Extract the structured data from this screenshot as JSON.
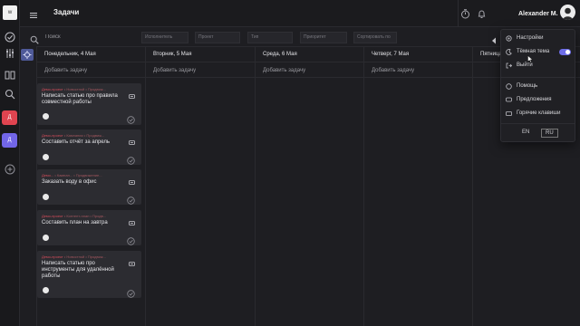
{
  "app": {
    "title": "Задачи",
    "logo_text": "w",
    "user_name": "Alexander M."
  },
  "rail": {
    "projects": [
      {
        "label": "Д",
        "color": "#e04450"
      },
      {
        "label": "Д",
        "color": "#7266e8"
      }
    ]
  },
  "filters": {
    "search_placeholder": "Поиск",
    "assignee": "Исполнитель",
    "project": "Проект",
    "type": "Тип",
    "priority": "Приоритет",
    "sort": "Сортировать по"
  },
  "columns": [
    {
      "day": "Понедельник, 4 Мая",
      "add": "Добавить задачу"
    },
    {
      "day": "Вторник, 5 Мая",
      "add": "Добавить задачу"
    },
    {
      "day": "Среда, 6 Мая",
      "add": "Добавить задачу"
    },
    {
      "day": "Четверг, 7 Мая",
      "add": "Добавить задачу"
    },
    {
      "day": "Пятница",
      "add": ""
    }
  ],
  "cards": [
    {
      "project": "Демо-проект",
      "crumb": " • Новостной • Продвиж...",
      "title": "Написать статью про правила совместной работы"
    },
    {
      "project": "Демо-проект",
      "crumb": " • Кампании • Продвиж...",
      "title": "Составить отчёт за апрель"
    },
    {
      "project": "Демо...",
      "crumb": " • Кампан... • Продвижение...",
      "title": "Заказать воду в офис"
    },
    {
      "project": "Демо-проект",
      "crumb": " • Контент-план • Продв...",
      "title": "Составить план на завтра"
    },
    {
      "project": "Демо-проект",
      "crumb": " • Новостной • Продвиж...",
      "title": "Написать статью про инструменты для удалённой работы"
    }
  ],
  "menu": {
    "settings": "Настройки",
    "dark_theme": "Тёмная тема",
    "dark_theme_on": true,
    "logout": "Выйти",
    "help": "Помощь",
    "suggestions": "Предложения",
    "hotkeys": "Горячие клавиши",
    "lang_en": "EN",
    "lang_ru": "RU"
  },
  "colors": {
    "accent": "#6e6ee8",
    "danger": "#e04450",
    "background": "#1e1e22"
  }
}
